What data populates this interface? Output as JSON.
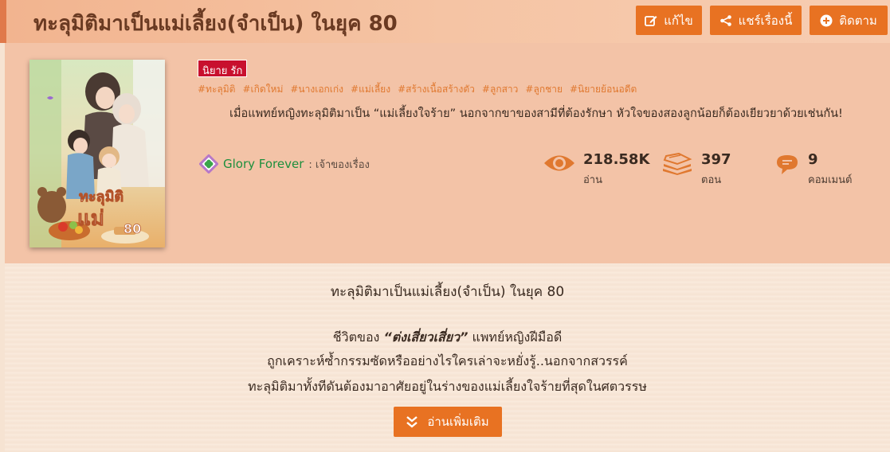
{
  "header": {
    "title": "ทะลุมิติมาเป็นแม่เลี้ยง(จำเป็น) ในยุค 80",
    "edit_label": "แก้ไข",
    "share_label": "แชร์เรื่องนี้",
    "follow_label": "ติดตาม",
    "accent_color": "#e87222"
  },
  "novel": {
    "genre_badge": "นิยาย รัก",
    "tags": [
      "#ทะลุมิติ",
      "#เกิดใหม่",
      "#นางเอกเก่ง",
      "#แม่เลี้ยง",
      "#สร้างเนื้อสร้างตัว",
      "#ลูกสาว",
      "#ลูกชาย",
      "#นิยายย้อนอดีต"
    ],
    "synopsis": "เมื่อแพทย์หญิงทะลุมิติมาเป็น “แม่เลี้ยงใจร้าย” นอกจากขาของสามีที่ต้องรักษา หัวใจของสองลูกน้อยก็ต้องเยียวยาด้วยเช่นกัน!",
    "author_name": "Glory Forever",
    "author_role": ": เจ้าของเรื่อง",
    "cover_title_art": "ทะลุมิติ มาเป็น แม่เลี้ยง ในยุค 80"
  },
  "stats": {
    "views_value": "218.58K",
    "views_label": "อ่าน",
    "chapters_value": "397",
    "chapters_label": "ตอน",
    "comments_value": "9",
    "comments_label": "คอมเมนต์"
  },
  "description": {
    "title": "ทะลุมิติมาเป็นแม่เลี้ยง(จำเป็น) ในยุค 80",
    "line1_prefix": "ชีวิตของ ",
    "line1_name": "“ต่งเสี่ยวเสี่ยว”",
    "line1_suffix": " แพทย์หญิงฝีมือดี",
    "line2": "ถูกเคราะห์ซ้ำกรรมซัดหรืออย่างไรใครเล่าจะหยั่งรู้..นอกจากสวรรค์",
    "line3": "ทะลุมิติมาทั้งทีดันต้องมาอาศัยอยู่ในร่างของแม่เลี้ยงใจร้ายที่สุดในศตวรรษ",
    "read_more_label": "อ่านเพิ่มเติม"
  }
}
